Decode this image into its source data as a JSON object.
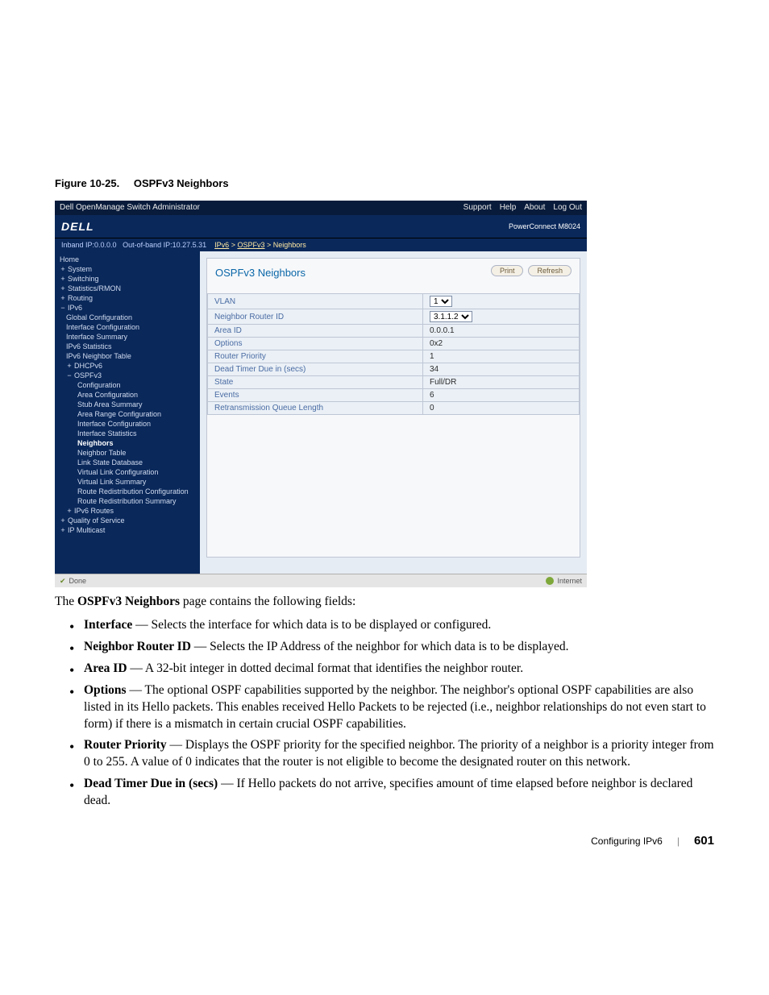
{
  "figure": {
    "num": "Figure 10-25.",
    "title": "OSPFv3 Neighbors"
  },
  "shot": {
    "window_title": "Dell OpenManage Switch Administrator",
    "toplinks": [
      "Support",
      "Help",
      "About",
      "Log Out"
    ],
    "brand": "DELL",
    "model": "PowerConnect M8024",
    "inband": "Inband IP:0.0.0.0",
    "oob": "Out-of-band IP:10.27.5.31",
    "crumb_ipv6": "IPv6",
    "crumb_ospf": "OSPFv3",
    "crumb_last": "Neighbors",
    "nav": [
      {
        "l": 0,
        "c": "",
        "t": "Home"
      },
      {
        "l": 0,
        "c": "box",
        "t": "System"
      },
      {
        "l": 0,
        "c": "box",
        "t": "Switching"
      },
      {
        "l": 0,
        "c": "box",
        "t": "Statistics/RMON"
      },
      {
        "l": 0,
        "c": "box",
        "t": "Routing"
      },
      {
        "l": 0,
        "c": "boxm",
        "t": "IPv6"
      },
      {
        "l": 1,
        "c": "",
        "t": "Global Configuration"
      },
      {
        "l": 1,
        "c": "",
        "t": "Interface Configuration"
      },
      {
        "l": 1,
        "c": "",
        "t": "Interface Summary"
      },
      {
        "l": 1,
        "c": "",
        "t": "IPv6 Statistics"
      },
      {
        "l": 1,
        "c": "",
        "t": "IPv6 Neighbor Table"
      },
      {
        "l": 1,
        "c": "box",
        "t": "DHCPv6"
      },
      {
        "l": 1,
        "c": "boxm",
        "t": "OSPFv3"
      },
      {
        "l": 2,
        "c": "",
        "t": "Configuration"
      },
      {
        "l": 2,
        "c": "",
        "t": "Area Configuration"
      },
      {
        "l": 2,
        "c": "",
        "t": "Stub Area Summary"
      },
      {
        "l": 2,
        "c": "",
        "t": "Area Range Configuration"
      },
      {
        "l": 2,
        "c": "",
        "t": "Interface Configuration"
      },
      {
        "l": 2,
        "c": "",
        "t": "Interface Statistics"
      },
      {
        "l": 2,
        "c": "active",
        "t": "Neighbors"
      },
      {
        "l": 2,
        "c": "",
        "t": "Neighbor Table"
      },
      {
        "l": 2,
        "c": "",
        "t": "Link State Database"
      },
      {
        "l": 2,
        "c": "",
        "t": "Virtual Link Configuration"
      },
      {
        "l": 2,
        "c": "",
        "t": "Virtual Link Summary"
      },
      {
        "l": 2,
        "c": "",
        "t": "Route Redistribution Configuration"
      },
      {
        "l": 2,
        "c": "",
        "t": "Route Redistribution Summary"
      },
      {
        "l": 1,
        "c": "box",
        "t": "IPv6 Routes"
      },
      {
        "l": 0,
        "c": "box",
        "t": "Quality of Service"
      },
      {
        "l": 0,
        "c": "box",
        "t": "IP Multicast"
      }
    ],
    "btn_print": "Print",
    "btn_refresh": "Refresh",
    "page_title": "OSPFv3 Neighbors",
    "rows": [
      {
        "label": "VLAN",
        "value": "1",
        "select": true
      },
      {
        "label": "Neighbor Router ID",
        "value": "3.1.1.2",
        "select": true
      },
      {
        "label": "Area ID",
        "value": "0.0.0.1"
      },
      {
        "label": "Options",
        "value": "0x2"
      },
      {
        "label": "Router Priority",
        "value": "1"
      },
      {
        "label": "Dead Timer Due in (secs)",
        "value": "34"
      },
      {
        "label": "State",
        "value": "Full/DR"
      },
      {
        "label": "Events",
        "value": "6"
      },
      {
        "label": "Retransmission Queue Length",
        "value": "0"
      }
    ],
    "status_left": "Done",
    "status_right": "Internet"
  },
  "intro": "The OSPFv3 Neighbors page contains the following fields:",
  "intro_bold": "OSPFv3 Neighbors",
  "bullets": [
    {
      "b": "Interface",
      "t": " — Selects the interface for which data is to be displayed or configured."
    },
    {
      "b": "Neighbor Router ID",
      "t": " — Selects the IP Address of the neighbor for which data is to be displayed."
    },
    {
      "b": "Area ID",
      "t": " — A 32-bit integer in dotted decimal format that identifies the neighbor router."
    },
    {
      "b": "Options",
      "t": " — The optional OSPF capabilities supported by the neighbor. The neighbor's optional OSPF capabilities are also listed in its Hello packets. This enables received Hello Packets to be rejected (i.e., neighbor relationships do not even start to form) if there is a mismatch in certain crucial OSPF capabilities."
    },
    {
      "b": "Router Priority",
      "t": " — Displays the OSPF priority for the specified neighbor. The priority of a neighbor is a priority integer from 0 to 255. A value of 0 indicates that the router is not eligible to become the designated router on this network."
    },
    {
      "b": "Dead Timer Due in (secs)",
      "t": " — If Hello packets do not arrive, specifies amount of time elapsed before neighbor is declared dead."
    }
  ],
  "footer": {
    "section": "Configuring IPv6",
    "page": "601"
  }
}
